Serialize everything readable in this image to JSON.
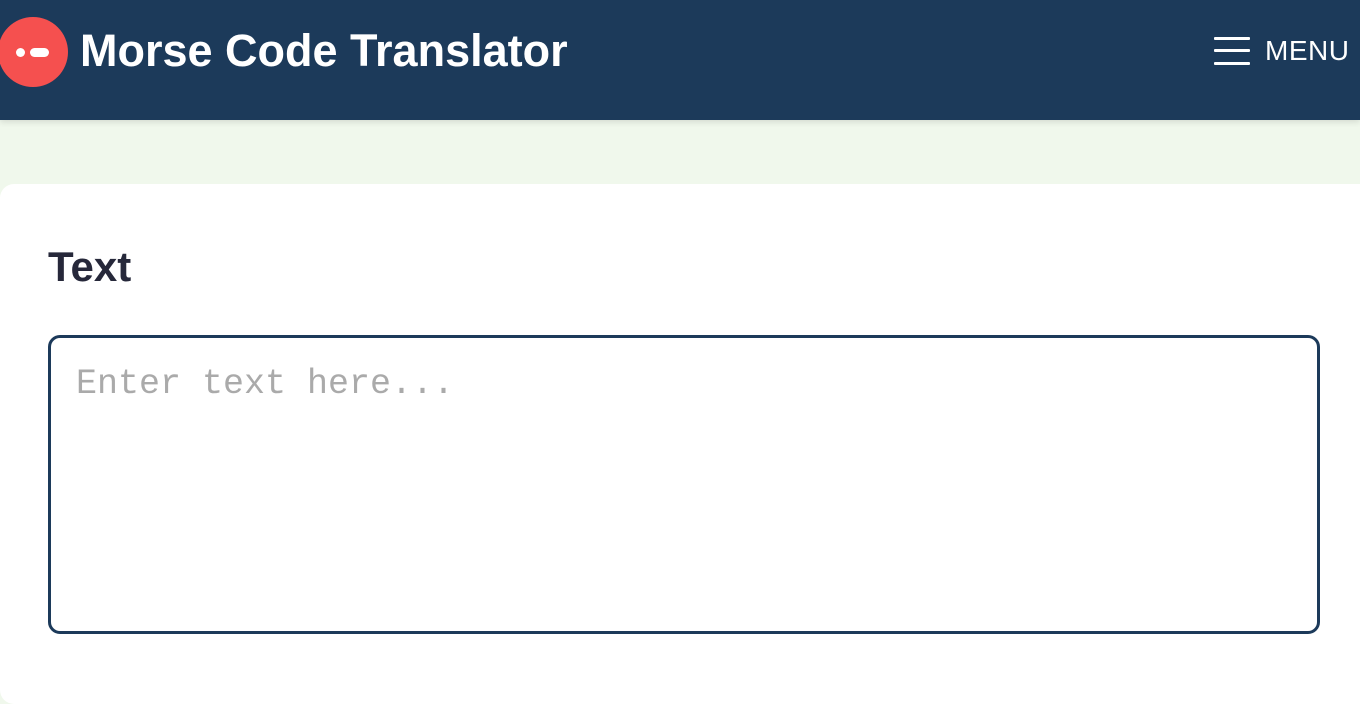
{
  "header": {
    "title": "Morse Code Translator",
    "logo_icon": "morse-dot-dash-icon",
    "menu_label": "MENU",
    "menu_icon": "hamburger-icon"
  },
  "input_section": {
    "label": "Text",
    "placeholder": "Enter text here...",
    "value": ""
  },
  "colors": {
    "header_bg": "#1c3a5a",
    "logo_bg": "#f5504f",
    "page_bg": "#f0f8ec",
    "card_bg": "#ffffff",
    "input_border": "#1c3a5a"
  }
}
